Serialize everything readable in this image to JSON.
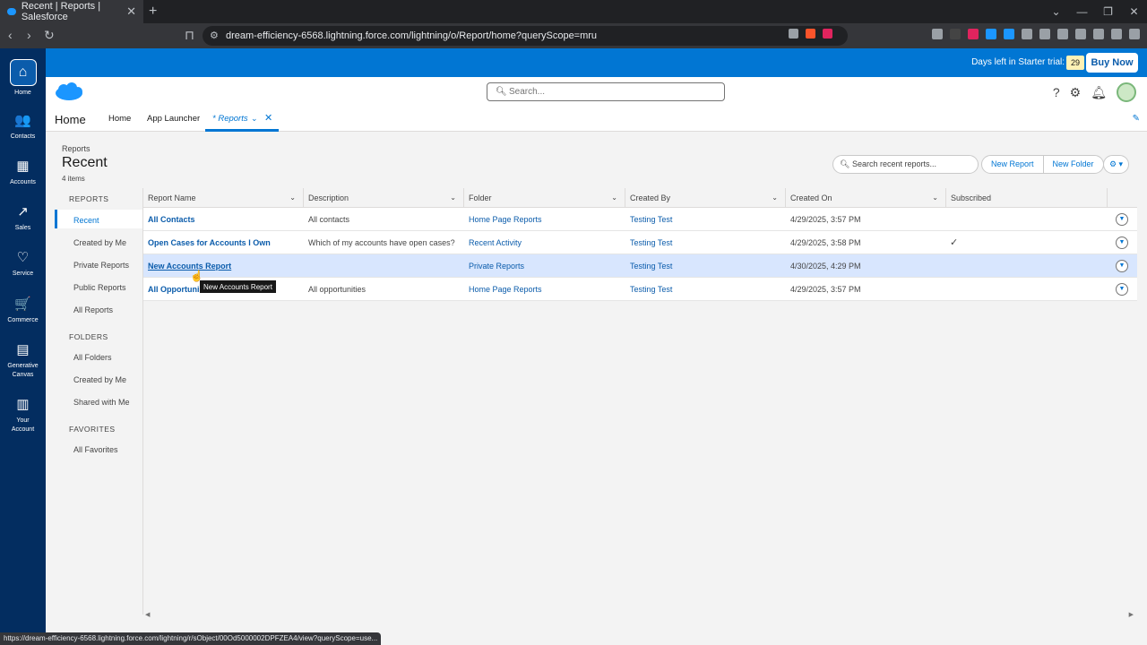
{
  "browser": {
    "tab_title": "Recent | Reports | Salesforce",
    "url": "dream-efficiency-6568.lightning.force.com/lightning/o/Report/home?queryScope=mru",
    "status_url": "https://dream-efficiency-6568.lightning.force.com/lightning/r/sObject/00Od5000002DPFZEA4/view?queryScope=use..."
  },
  "left_nav": [
    {
      "label": "Home",
      "icon": "home-icon"
    },
    {
      "label": "Contacts",
      "icon": "contacts-icon"
    },
    {
      "label": "Accounts",
      "icon": "accounts-icon"
    },
    {
      "label": "Sales",
      "icon": "sales-icon"
    },
    {
      "label": "Service",
      "icon": "heart-icon"
    },
    {
      "label": "Commerce",
      "icon": "cart-icon"
    },
    {
      "label": "Generative",
      "label2": "Canvas",
      "icon": "canvas-icon"
    },
    {
      "label": "Your",
      "label2": "Account",
      "icon": "account-icon"
    }
  ],
  "trial": {
    "text": "Days left in Starter trial:",
    "count": "29",
    "buy_label": "Buy Now"
  },
  "header": {
    "search_placeholder": "Search..."
  },
  "app_tabs": {
    "app_name": "Home",
    "home": "Home",
    "launcher": "App Launcher",
    "reports": "* Reports"
  },
  "page": {
    "breadcrumb": "Reports",
    "title": "Recent",
    "count": "4 items",
    "search_placeholder": "Search recent reports...",
    "new_report": "New Report",
    "new_folder": "New Folder"
  },
  "sidebar": {
    "reports_header": "REPORTS",
    "reports_items": [
      "Recent",
      "Created by Me",
      "Private Reports",
      "Public Reports",
      "All Reports"
    ],
    "folders_header": "FOLDERS",
    "folders_items": [
      "All Folders",
      "Created by Me",
      "Shared with Me"
    ],
    "favorites_header": "FAVORITES",
    "favorites_items": [
      "All Favorites"
    ]
  },
  "table": {
    "columns": [
      "Report Name",
      "Description",
      "Folder",
      "Created By",
      "Created On",
      "Subscribed"
    ],
    "rows": [
      {
        "name": "All Contacts",
        "description": "All contacts",
        "folder": "Home Page Reports",
        "created_by": "Testing Test",
        "created_on": "4/29/2025, 3:57 PM",
        "subscribed": false
      },
      {
        "name": "Open Cases for Accounts I Own",
        "description": "Which of my accounts have open cases?",
        "folder": "Recent Activity",
        "created_by": "Testing Test",
        "created_on": "4/29/2025, 3:58 PM",
        "subscribed": true
      },
      {
        "name": "New Accounts Report",
        "description": "",
        "folder": "Private Reports",
        "created_by": "Testing Test",
        "created_on": "4/30/2025, 4:29 PM",
        "subscribed": false
      },
      {
        "name": "All Opportunities",
        "description": "All opportunities",
        "folder": "Home Page Reports",
        "created_by": "Testing Test",
        "created_on": "4/29/2025, 3:57 PM",
        "subscribed": false
      }
    ]
  },
  "tooltip": "New Accounts Report"
}
